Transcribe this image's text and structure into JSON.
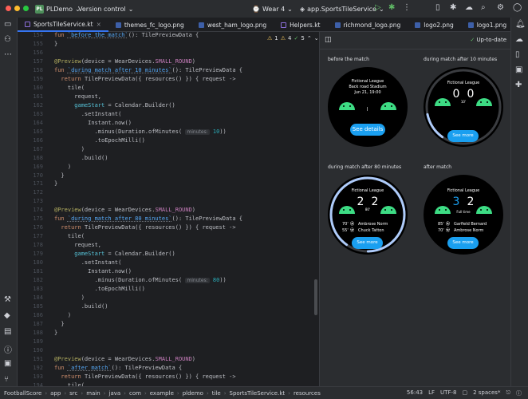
{
  "titlebar": {
    "project": "PLDemo",
    "project_badge": "PL",
    "vcs": "Version control",
    "device": "Wear 4",
    "run_config": "app.SportsTileService"
  },
  "tabs": [
    {
      "label": "SportsTileService.kt",
      "type": "kt",
      "active": true
    },
    {
      "label": "themes_fc_logo.png",
      "type": "png"
    },
    {
      "label": "west_ham_logo.png",
      "type": "png"
    },
    {
      "label": "Helpers.kt",
      "type": "kt"
    },
    {
      "label": "richmond_logo.png",
      "type": "png"
    },
    {
      "label": "logo2.png",
      "type": "png"
    },
    {
      "label": "logo1.png",
      "type": "png"
    }
  ],
  "inspections": {
    "warn1": "1",
    "warn2": "4",
    "ok": "5"
  },
  "editor": {
    "lines": [
      {
        "n": "154",
        "t": [
          [
            "kw",
            "fun "
          ],
          [
            "fnn",
            "`before the match`"
          ],
          [
            "pl",
            "(): TilePreviewData {"
          ]
        ]
      },
      {
        "n": "155",
        "t": [
          [
            "pl",
            "}"
          ]
        ]
      },
      {
        "n": "156",
        "t": []
      },
      {
        "n": "157",
        "t": [
          [
            "an",
            "@Preview"
          ],
          [
            "pl",
            "(device = WearDevices."
          ],
          [
            "cn",
            "SMALL_ROUND"
          ],
          [
            "pl",
            ")"
          ]
        ]
      },
      {
        "n": "158",
        "t": [
          [
            "kw",
            "fun "
          ],
          [
            "fnn",
            "`during match after 10 minutes`"
          ],
          [
            "pl",
            "(): TilePreviewData {"
          ]
        ]
      },
      {
        "n": "159",
        "t": [
          [
            "kw",
            "  return "
          ],
          [
            "pl",
            "TilePreviewData({ resources() }) { request ->"
          ]
        ]
      },
      {
        "n": "160",
        "t": [
          [
            "pl",
            "    tile("
          ]
        ]
      },
      {
        "n": "161",
        "t": [
          [
            "pl",
            "      request,"
          ]
        ]
      },
      {
        "n": "162",
        "t": [
          [
            "pm",
            "      gameStart"
          ],
          [
            "pl",
            " = Calendar.Builder()"
          ]
        ]
      },
      {
        "n": "163",
        "t": [
          [
            "pl",
            "        .setInstant("
          ]
        ]
      },
      {
        "n": "164",
        "t": [
          [
            "pl",
            "          Instant.now()"
          ]
        ]
      },
      {
        "n": "165",
        "t": [
          [
            "pl",
            "            .minus(Duration.ofMinutes( "
          ],
          [
            "hint",
            "minutes:"
          ],
          [
            "nm",
            " 10"
          ],
          [
            "pl",
            "))"
          ]
        ]
      },
      {
        "n": "166",
        "t": [
          [
            "pl",
            "            .toEpochMilli()"
          ]
        ]
      },
      {
        "n": "167",
        "t": [
          [
            "pl",
            "        )"
          ]
        ]
      },
      {
        "n": "168",
        "t": [
          [
            "pl",
            "        .build()"
          ]
        ]
      },
      {
        "n": "169",
        "t": [
          [
            "pl",
            "    )"
          ]
        ]
      },
      {
        "n": "170",
        "t": [
          [
            "pl",
            "  }"
          ]
        ]
      },
      {
        "n": "171",
        "t": [
          [
            "pl",
            "}"
          ]
        ]
      },
      {
        "n": "172",
        "t": []
      },
      {
        "n": "173",
        "t": []
      },
      {
        "n": "174",
        "t": [
          [
            "an",
            "@Preview"
          ],
          [
            "pl",
            "(device = WearDevices."
          ],
          [
            "cn",
            "SMALL_ROUND"
          ],
          [
            "pl",
            ")"
          ]
        ]
      },
      {
        "n": "175",
        "t": [
          [
            "kw",
            "fun "
          ],
          [
            "fnn",
            "`during match after 80 minutes`"
          ],
          [
            "pl",
            "(): TilePreviewData {"
          ]
        ]
      },
      {
        "n": "176",
        "t": [
          [
            "kw",
            "  return "
          ],
          [
            "pl",
            "TilePreviewData({ resources() }) { request ->"
          ]
        ]
      },
      {
        "n": "177",
        "t": [
          [
            "pl",
            "    tile("
          ]
        ]
      },
      {
        "n": "178",
        "t": [
          [
            "pl",
            "      request,"
          ]
        ]
      },
      {
        "n": "179",
        "t": [
          [
            "pm",
            "      gameStart"
          ],
          [
            "pl",
            " = Calendar.Builder()"
          ]
        ]
      },
      {
        "n": "180",
        "t": [
          [
            "pl",
            "        .setInstant("
          ]
        ]
      },
      {
        "n": "181",
        "t": [
          [
            "pl",
            "          Instant.now()"
          ]
        ]
      },
      {
        "n": "182",
        "t": [
          [
            "pl",
            "            .minus(Duration.ofMinutes( "
          ],
          [
            "hint",
            "minutes:"
          ],
          [
            "nm",
            " 80"
          ],
          [
            "pl",
            "))"
          ]
        ]
      },
      {
        "n": "183",
        "t": [
          [
            "pl",
            "            .toEpochMilli()"
          ]
        ]
      },
      {
        "n": "184",
        "t": [
          [
            "pl",
            "        )"
          ]
        ]
      },
      {
        "n": "185",
        "t": [
          [
            "pl",
            "        .build()"
          ]
        ]
      },
      {
        "n": "186",
        "t": [
          [
            "pl",
            "    )"
          ]
        ]
      },
      {
        "n": "187",
        "t": [
          [
            "pl",
            "  }"
          ]
        ]
      },
      {
        "n": "188",
        "t": [
          [
            "pl",
            "}"
          ]
        ]
      },
      {
        "n": "189",
        "t": []
      },
      {
        "n": "190",
        "t": []
      },
      {
        "n": "191",
        "t": [
          [
            "an",
            "@Preview"
          ],
          [
            "pl",
            "(device = WearDevices."
          ],
          [
            "cn",
            "SMALL_ROUND"
          ],
          [
            "pl",
            ")"
          ]
        ]
      },
      {
        "n": "192",
        "t": [
          [
            "kw",
            "fun "
          ],
          [
            "fnn",
            "`after match`"
          ],
          [
            "pl",
            "(): TilePreviewData {"
          ]
        ]
      },
      {
        "n": "193",
        "t": [
          [
            "kw",
            "  return "
          ],
          [
            "pl",
            "TilePreviewData({ resources() }) { request ->"
          ]
        ]
      },
      {
        "n": "194",
        "t": [
          [
            "pl",
            "    tile("
          ]
        ]
      }
    ]
  },
  "preview": {
    "status": "Up-to-date",
    "previews": [
      {
        "label": "before the match",
        "league": "Fictional League",
        "venue": "Back road Stadium",
        "date": "Jun 21, 19:00",
        "button": "See details"
      },
      {
        "label": "during match after 10 minutes",
        "league": "Fictional League",
        "home": "0",
        "away": "0",
        "minute": "10'",
        "button": "See more",
        "progress": 0.12
      },
      {
        "label": "during match after 80 minutes",
        "league": "Fictional League",
        "home": "2",
        "away": "2",
        "minute": "80'",
        "button": "See more",
        "progress": 0.9,
        "events": [
          [
            "70'",
            "Ambrose Norm"
          ],
          [
            "55'",
            "Chuck Tatton"
          ]
        ]
      },
      {
        "label": "after match",
        "league": "Fictional League",
        "home": "3",
        "away": "2",
        "minute": "Full time",
        "button": "See more",
        "events": [
          [
            "85'",
            "Garfield Bernard"
          ],
          [
            "70'",
            "Ambrose Norm"
          ]
        ]
      }
    ]
  },
  "status": {
    "breadcrumbs": [
      "FootballScore",
      "app",
      "src",
      "main",
      "java",
      "com",
      "example",
      "pldemo",
      "tile",
      "SportsTileService.kt",
      "resources"
    ],
    "position": "56:43",
    "line_sep": "LF",
    "encoding": "UTF-8",
    "indent": "2 spaces*"
  },
  "colors": {
    "accent": "#3574f0",
    "tile_button": "#1a9ff0",
    "android": "#3ddc84",
    "winner_score": "#1a9ff0"
  }
}
